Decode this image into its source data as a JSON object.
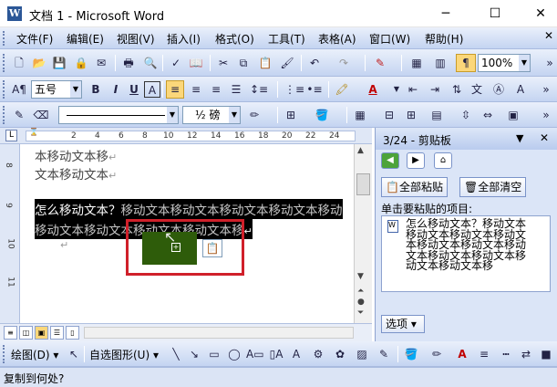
{
  "window": {
    "title": "文档 1 - Microsoft Word",
    "app_icon": "W"
  },
  "menu": [
    "文件(F)",
    "编辑(E)",
    "视图(V)",
    "插入(I)",
    "格式(O)",
    "工具(T)",
    "表格(A)",
    "窗口(W)",
    "帮助(H)"
  ],
  "toolbar": {
    "zoom": "100%"
  },
  "format": {
    "font_size": "五号",
    "bold": "B",
    "italic": "I",
    "underline": "U",
    "char_frame": "A",
    "font_color": "A"
  },
  "line_tools": {
    "weight": "½ 磅"
  },
  "ruler": {
    "marks": [
      "2",
      "4",
      "6",
      "8",
      "10",
      "12",
      "14",
      "16",
      "18",
      "20",
      "22",
      "24"
    ],
    "side": [
      "8",
      "9",
      "10",
      "11"
    ]
  },
  "document": {
    "line1": "本移动文本移",
    "line2": "文本移动文本",
    "selected_bold": "怎么移动文本？",
    "selected_rest1": "移动文本移动文本移动文本移动文本移动",
    "selected_line2": "移动文本移动文本移动文本移动文本移",
    "pmark": "↵"
  },
  "clipboard_pane": {
    "title": "3/24 - 剪贴板",
    "paste_all": "全部粘贴",
    "clear_all": "全部清空",
    "instruction": "单击要粘贴的项目:",
    "item_text": "怎么移动文本？移动文本移动文本移动文本移动文本移动文本移动文本移动文本移动文本移动文本移动文本移动文本移",
    "options": "选项 ▾"
  },
  "drawing": {
    "draw_label": "绘图(D) ▾",
    "autoshapes_label": "自选图形(U) ▾"
  },
  "status": {
    "text": "复制到何处?"
  },
  "colors": {
    "accent": "#2b5797",
    "highlight_box": "#d0202a",
    "drag_block": "#2e5c0a"
  }
}
